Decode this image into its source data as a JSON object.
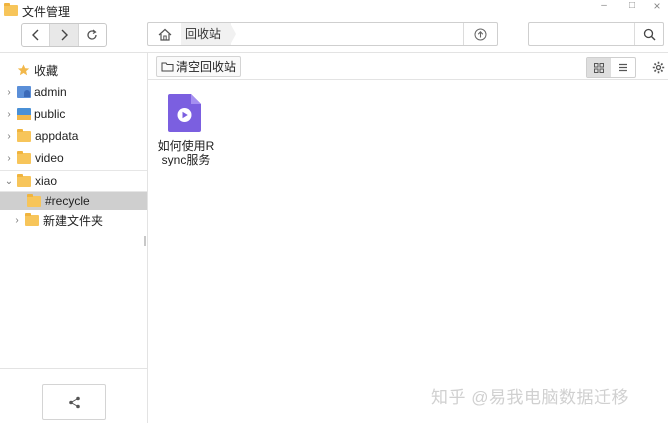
{
  "window": {
    "title": "文件管理",
    "minimize_glyph": "–",
    "maximize_glyph": "□",
    "close_glyph": "×"
  },
  "toolbar": {
    "back_icon": "chevron-left-icon",
    "forward_icon": "chevron-right-icon",
    "refresh_icon": "refresh-icon"
  },
  "address": {
    "home_icon": "home-icon",
    "breadcrumb": "回收站",
    "up_icon": "upload-icon"
  },
  "search": {
    "value": "",
    "placeholder": "",
    "icon": "search-icon"
  },
  "sidebar": {
    "items": [
      {
        "label": "收藏",
        "icon": "star-icon"
      },
      {
        "label": "admin",
        "icon": "user-folder-icon"
      },
      {
        "label": "public",
        "icon": "shared-folder-icon"
      },
      {
        "label": "appdata",
        "icon": "folder-icon"
      },
      {
        "label": "video",
        "icon": "folder-icon"
      },
      {
        "label": "xiao",
        "icon": "folder-icon"
      },
      {
        "label": "#recycle",
        "icon": "folder-icon"
      },
      {
        "label": "新建文件夹",
        "icon": "folder-icon"
      }
    ],
    "share_icon": "share-icon"
  },
  "content": {
    "empty_trash_label": "清空回收站",
    "view_modes": [
      "grid-view-icon",
      "list-view-icon"
    ],
    "active_view": "grid",
    "settings_icon": "gear-icon",
    "files": [
      {
        "name": "如何使用Rsync服务",
        "icon": "video-file-icon"
      }
    ]
  },
  "colors": {
    "folder": "#f7c55a",
    "video_file": "#7b5fe0",
    "selected_row": "#cfcfcf"
  },
  "watermark": "知乎 @易我电脑数据迁移"
}
